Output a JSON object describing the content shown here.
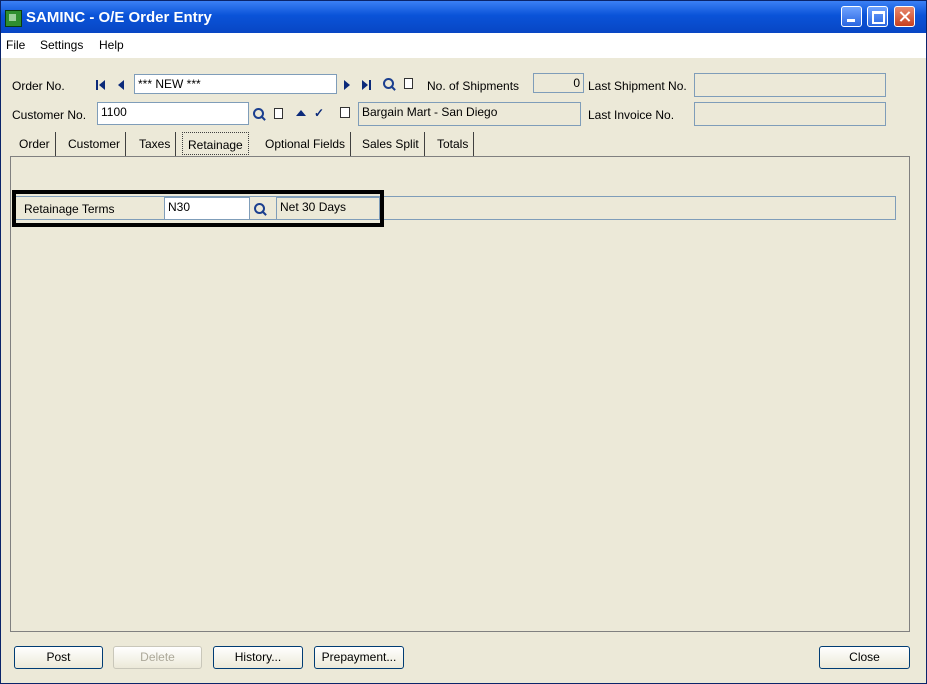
{
  "window": {
    "title": "SAMINC - O/E Order Entry"
  },
  "menu": [
    "File",
    "Settings",
    "Help"
  ],
  "header": {
    "order_no_label": "Order No.",
    "order_no_value": "*** NEW ***",
    "shipments_label": "No. of Shipments",
    "shipments_value": "0",
    "last_shipment_label": "Last Shipment No.",
    "last_shipment_value": "",
    "customer_no_label": "Customer No.",
    "customer_no_value": "1100",
    "customer_name": "Bargain Mart - San Diego",
    "last_invoice_label": "Last Invoice No.",
    "last_invoice_value": ""
  },
  "tabs": [
    "Order",
    "Customer",
    "Taxes",
    "Retainage",
    "Optional Fields",
    "Sales Split",
    "Totals"
  ],
  "active_tab": "Retainage",
  "retainage": {
    "terms_label": "Retainage Terms",
    "terms_code": "N30",
    "terms_description": "Net 30 Days"
  },
  "buttons": {
    "post": "Post",
    "delete": "Delete",
    "history": "History...",
    "prepayment": "Prepayment...",
    "close": "Close"
  },
  "colors": {
    "titlebar": "#0a53d8",
    "window_bg": "#ece9d8",
    "highlight_border": "#000000"
  },
  "icons": [
    "first-record-icon",
    "previous-record-icon",
    "next-record-icon",
    "last-record-icon",
    "finder-icon",
    "new-document-icon",
    "zoom-icon",
    "drilldown-icon",
    "customer-detail-icon"
  ]
}
